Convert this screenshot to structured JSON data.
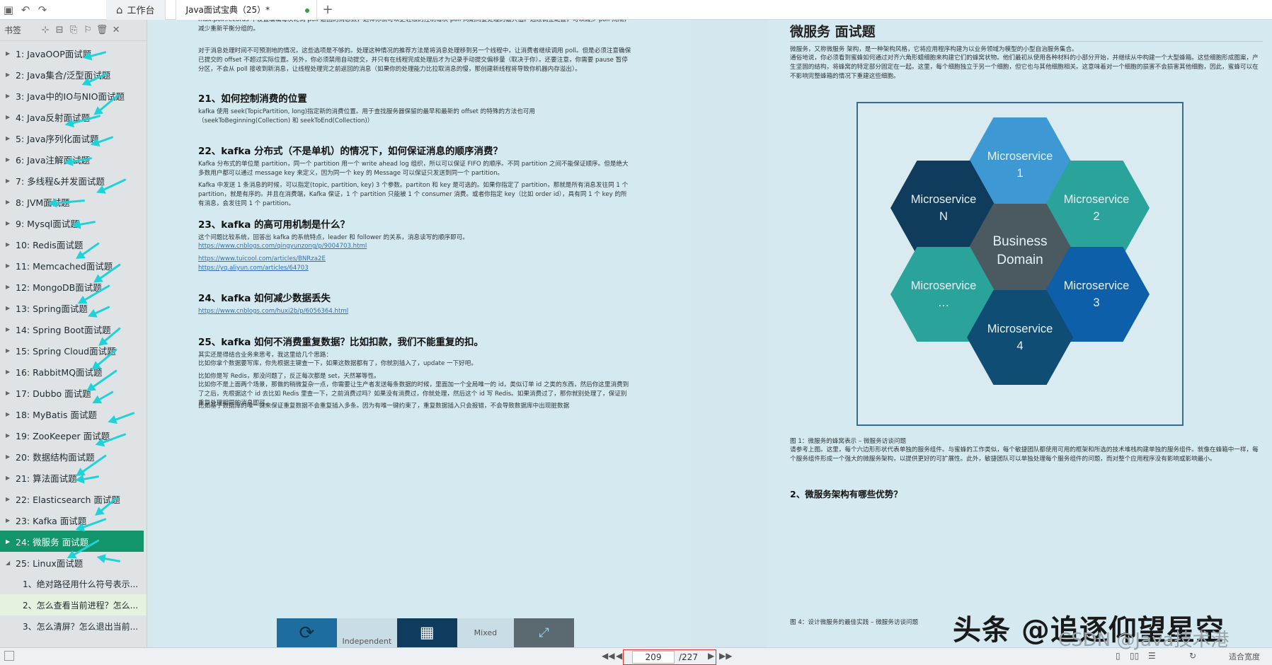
{
  "tabs": {
    "home_label": "工作台",
    "doc_label": "Java面试宝典（25）*"
  },
  "sidebar": {
    "title": "书签",
    "items": [
      {
        "label": "1: JavaOOP面试题"
      },
      {
        "label": "2: Java集合/泛型面试题"
      },
      {
        "label": "3: Java中的IO与NIO面试题"
      },
      {
        "label": "4: Java反射面试题"
      },
      {
        "label": "5: Java序列化面试题"
      },
      {
        "label": "6: Java注解面试题"
      },
      {
        "label": "7: 多线程&并发面试题"
      },
      {
        "label": "8: JVM面试题"
      },
      {
        "label": "9: Mysql面试题"
      },
      {
        "label": "10: Redis面试题"
      },
      {
        "label": "11: Memcached面试题"
      },
      {
        "label": "12: MongoDB面试题"
      },
      {
        "label": "13: Spring面试题"
      },
      {
        "label": "14: Spring Boot面试题"
      },
      {
        "label": "15: Spring Cloud面试题"
      },
      {
        "label": "16: RabbitMQ面试题"
      },
      {
        "label": "17: Dubbo 面试题"
      },
      {
        "label": "18: MyBatis 面试题"
      },
      {
        "label": "19: ZooKeeper 面试题"
      },
      {
        "label": "20: 数据结构面试题"
      },
      {
        "label": "21: 算法面试题"
      },
      {
        "label": "22: Elasticsearch 面试题"
      },
      {
        "label": "23: Kafka 面试题"
      },
      {
        "label": "24: 微服务 面试题"
      },
      {
        "label": "25: Linux面试题"
      }
    ],
    "children": [
      {
        "label": "1、绝对路径用什么符号表示..."
      },
      {
        "label": "2、怎么查看当前进程？怎么..."
      },
      {
        "label": "3、怎么清屏？怎么退出当前..."
      }
    ]
  },
  "left_page": {
    "top_text_a": "max.poll.records 中设置编辑每次轮询 poll 返回的消息数，这样你就可以更轻松的控制每次 poll 同期间要处理的最大值。通过调整配置，可以减少 poll 间隔，减少重新平衡分组的。",
    "top_text_b": "对于消息处理时间不可预测地的情况，这些选项是不够的。处理这种情况的推荐方法是将消息处理移到另一个线程中，让消费者继续调用 poll。但是必须注意确保已提交的 offset 不超过实际位置。另外，你必须禁用自动提交，并只有在线程完成处理后才为记录手动提交偏移量（取决于你）。还要注意，你需要 pause 暂停分区，不会从 poll 接收到新消息，让线程处理完之前返回的消息（如果你的处理能力比拉取消息的慢，那创建新线程将导致你机器内存溢出）。",
    "h21": "21、如何控制消费的位置",
    "t21": "kafka 使用 seek(TopicPartition, long)指定新的消费位置。用于查找服务器保留的最早和最新的 offset 的特殊的方法也可用（seekToBeginning(Collection) 和 seekToEnd(Collection)）",
    "h22": "22、kafka 分布式（不是单机）的情况下，如何保证消息的顺序消费？",
    "t22a": "Kafka 分布式的单位是 partition，同一个 partition 用一个 write ahead log 组织，所以可以保证 FIFO 的顺序。不同 partition 之间不能保证顺序。但是绝大多数用户都可以通过 message key 来定义，因为同一个 key 的 Message 可以保证只发送到同一个 partition。",
    "t22b": "Kafka 中发送 1 条消息的时候，可以指定(topic, partition, key) 3 个参数。partiton 和 key 是可选的。如果你指定了 partition，那就是所有消息发往同 1 个 partition，就是有序的。并且在消费端，Kafka 保证，1 个 partition 只能被 1 个 consumer 消费。或者你指定 key（比如 order id），具有同 1 个 key 的所有消息，会发往同 1 个 partition。",
    "h23": "23、kafka 的高可用机制是什么？",
    "t23": "这个问题比较系统，回答出 kafka 的系统特点，leader 和 follower 的关系，消息读写的顺序即可。",
    "l23a": "https://www.cnblogs.com/qingyunzong/p/9004703.html",
    "l23b": "https://www.tuicool.com/articles/BNRza2E",
    "l23c": "https://yq.aliyun.com/articles/64703",
    "h24": "24、kafka 如何减少数据丢失",
    "l24": "https://www.cnblogs.com/huxi2b/p/6056364.html",
    "h25": "25、kafka 如何不消费重复数据？比如扣款，我们不能重复的扣。",
    "t25a": "其实还是得结合业务来思考，我这里给几个思路：",
    "t25b": "比如你拿个数据要写库，你先根据主键查一下，如果这数据都有了，你就别插入了，update 一下好吧。",
    "t25c": "比如你是写 Redis，那没问题了，反正每次都是 set，天然幂等性。",
    "t25d": "比如你不是上面两个场景，那做的稍微复杂一点，你需要让生产者发送每条数据的时候，里面加一个全局唯一的 id，类似订单 id 之类的东西，然后你这里消费到了之后，先根据这个 id 去比如 Redis 里查一下，之前消费过吗？如果没有消费过，你就处理，然后这个 id 写 Redis。如果消费过了，那你就别处理了，保证别重复处理相同的消息即可。",
    "t25e": "比如基于数据库的唯一键来保证重复数据不会重复插入多条。因为有唯一键约束了，重复数据插入只会报错，不会导致数据库中出现脏数据",
    "strip_a": "Independent",
    "strip_b": "Mixed"
  },
  "right_page": {
    "title": "微服务 面试题",
    "intro_a": "微服务，又称微服务 架构，是一种架构风格，它将应用程序构建为以业务领域为模型的小型自治服务集合。",
    "intro_b": "通俗地说，你必须看到蜜蜂如何通过对齐六角形蜡细胞来构建它们的蜂窝状物。他们最初从使用各种材料的小部分开始，并继续从中构建一个大型蜂箱。这些细胞形成图案，产生坚固的结构，将蜂窝的特定部分固定在一起。这里，每个细胞独立于另一个细胞，但它也与其他细胞相关。这意味着对一个细胞的损害不会损害其他细胞，因此，蜜蜂可以在不影响完整蜂箱的情况下重建这些细胞。",
    "hex_1": "Microservice 1",
    "hex_2": "Microservice 2",
    "hex_3": "Microservice 3",
    "hex_4": "Microservice 4",
    "hex_n": "Microservice N",
    "hex_more": "Microservice …",
    "hex_center": "Business Domain",
    "caption1": "图 1：微服务的蜂窝表示 – 微服务访谈问题",
    "caption1b": "请参考上图。这里，每个六边形形状代表单独的服务组件。与蜜蜂的工作类似，每个敏捷团队都使用可用的框架和所选的技术堆栈构建单独的服务组件。就像在蜂箱中一样，每个服务组件形成一个强大的微服务架构，以提供更好的可扩展性。此外，敏捷团队可以单独处理每个服务组件的问题，而对整个应用程序没有影响或影响最小。",
    "h2": "2、微服务架构有哪些优势？",
    "caption4": "图 4：设计微服务的最佳实践 – 微服务访谈问题"
  },
  "bottom": {
    "current_page": "209",
    "total_pages": "/227",
    "fit_label": "适合宽度"
  },
  "watermark": {
    "main": "头条 @追逐仰望星空",
    "csdn": "CSDN @Java技术港"
  },
  "colors": {
    "accent": "#13956b",
    "arrow": "#1ed3d8",
    "hex_dark": "#0f3b5c",
    "hex_teal": "#2aa39a",
    "hex_blue": "#3e98d3",
    "hex_center": "#4a5a60"
  }
}
